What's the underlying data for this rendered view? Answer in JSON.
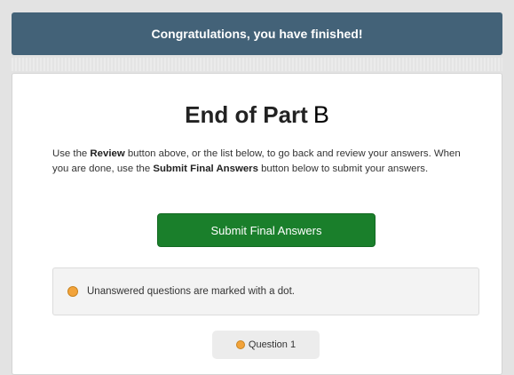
{
  "banner": {
    "text": "Congratulations, you have finished!"
  },
  "main": {
    "title": "End of Part",
    "part_letter": "B",
    "instructions": {
      "part1": "Use the ",
      "review_word": "Review",
      "part2": " button above, or the list below, to go back and review your answers. When you are done, use the ",
      "submit_word": "Submit Final Answers",
      "part3": " button below to submit your answers."
    },
    "submit_button_label": "Submit Final Answers",
    "note_text": "Unanswered questions are marked with a dot.",
    "questions": [
      {
        "label": "Question 1",
        "answered": false
      }
    ]
  },
  "colors": {
    "banner": "#436278",
    "submit_button": "#1a7f2b",
    "unanswered_dot": "#f2a33a"
  },
  "icons": {
    "unanswered_marker": "unanswered-dot-icon"
  }
}
